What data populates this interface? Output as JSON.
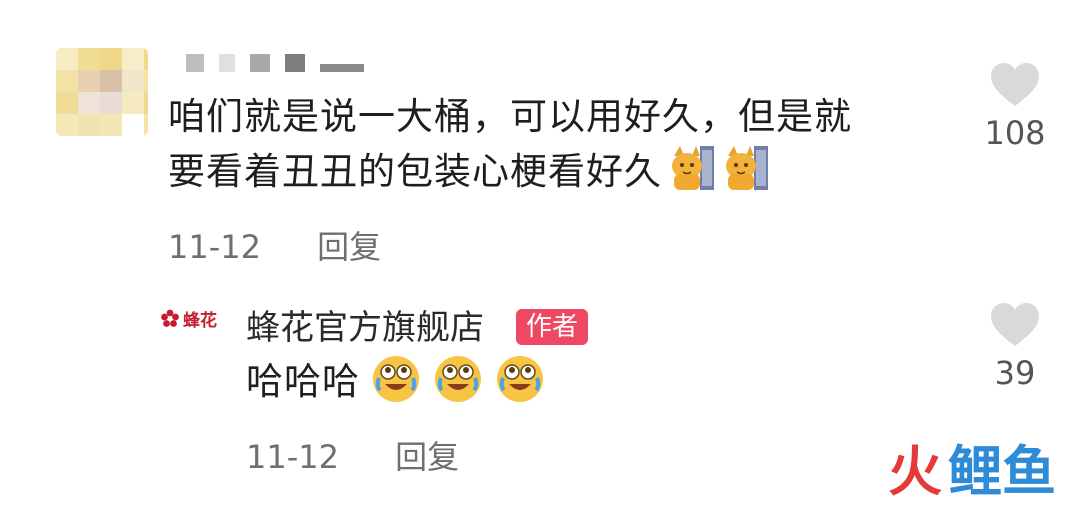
{
  "comment": {
    "text_line1": "咱们就是说一大桶，可以用好久，但是就",
    "text_line2": "要看着丑丑的包装心梗看好久",
    "emoji": [
      "cat-emoji",
      "cat-emoji"
    ],
    "date": "11-12",
    "reply_label": "回复",
    "likes": "108"
  },
  "reply": {
    "logo_text": "蜂花",
    "author_name": "蜂花官方旗舰店",
    "author_tag": "作者",
    "text": "哈哈哈",
    "emoji": [
      "laughing-crying-emoji",
      "laughing-crying-emoji",
      "laughing-crying-emoji"
    ],
    "date": "11-12",
    "reply_label": "回复",
    "likes": "39"
  },
  "watermark": {
    "part1": "火",
    "part2": "鲤鱼"
  },
  "colors": {
    "heart": "#d9d9d9",
    "tag": "#ee4863",
    "logo": "#c41e2c"
  }
}
